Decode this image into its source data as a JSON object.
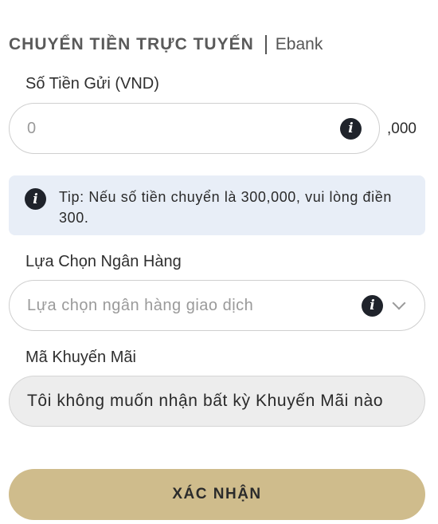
{
  "header": {
    "title": "CHUYỂN TIỀN TRỰC TUYẾN",
    "subtitle": "Ebank"
  },
  "amount": {
    "label": "Số Tiền Gửi (VND)",
    "value": "0",
    "suffix": ",000",
    "info_icon": "info-icon"
  },
  "tip": {
    "icon": "info-icon",
    "text": "Tip: Nếu số tiền chuyển là 300,000, vui lòng điền 300."
  },
  "bank": {
    "label": "Lựa Chọn Ngân Hàng",
    "placeholder": "Lựa chọn ngân hàng giao dịch",
    "info_icon": "info-icon",
    "dropdown_icon": "chevron-down-icon"
  },
  "promo": {
    "label": "Mã Khuyến Mãi",
    "value": "Tôi không muốn nhận bất kỳ Khuyến Mãi nào"
  },
  "submit": {
    "label": "XÁC NHẬN"
  },
  "colors": {
    "submit_bg": "#cfbc8c",
    "tip_bg": "#e8eef7",
    "icon_dark": "#1f232b"
  }
}
